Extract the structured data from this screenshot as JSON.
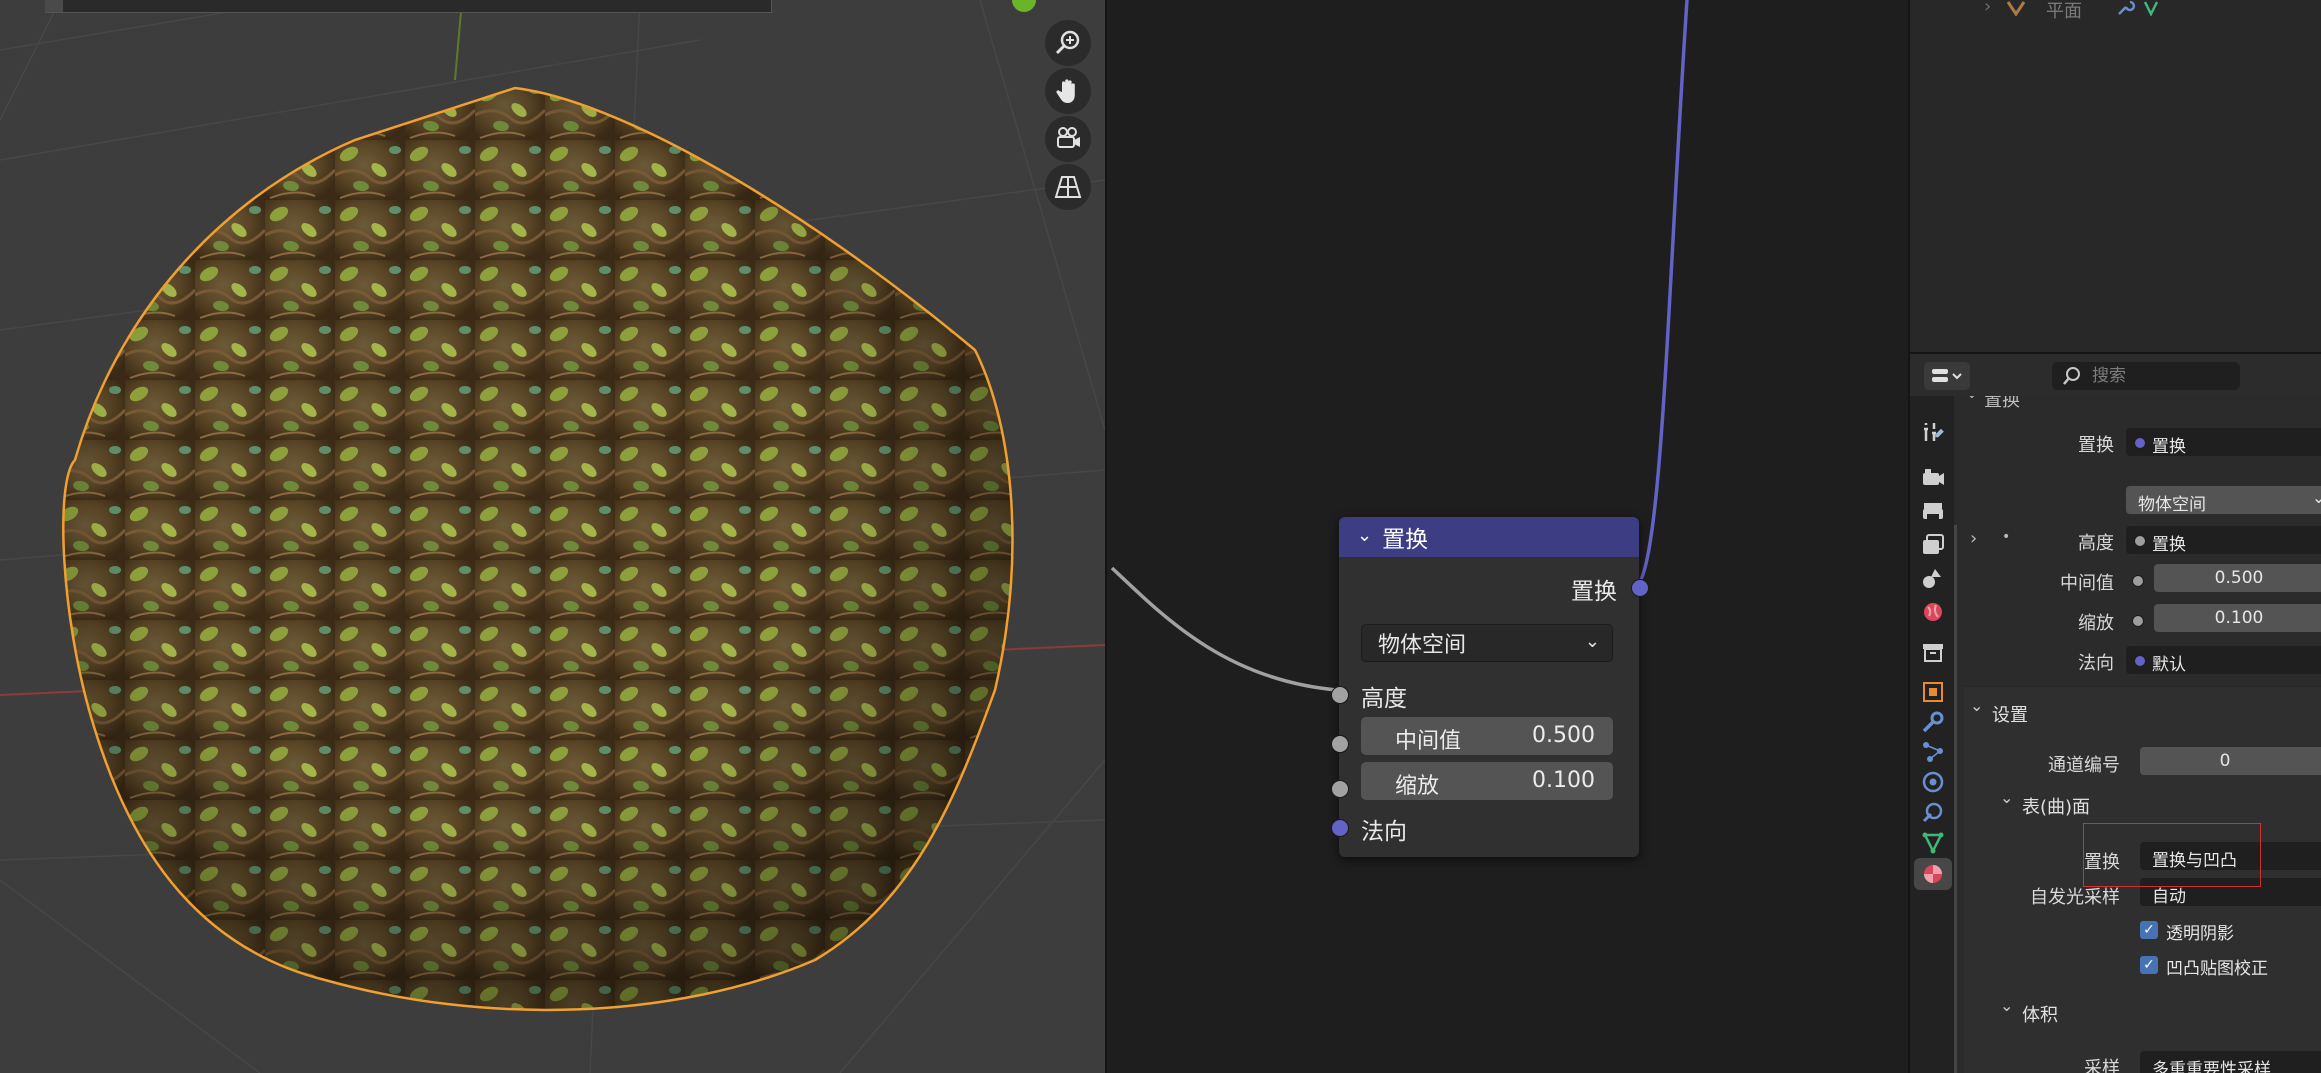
{
  "viewport": {
    "gizmo_buttons": [
      {
        "icon": "zoom-icon"
      },
      {
        "icon": "hand-pan-icon"
      },
      {
        "icon": "camera-icon"
      },
      {
        "icon": "perspective-grid-icon"
      }
    ]
  },
  "node": {
    "title": "置换",
    "output_label": "置换",
    "space_value": "物体空间",
    "inputs": {
      "height": "高度",
      "midlevel_label": "中间值",
      "midlevel_value": "0.500",
      "scale_label": "缩放",
      "scale_value": "0.100",
      "normal": "法向"
    }
  },
  "outliner": {
    "row_label": "平面"
  },
  "properties": {
    "search_placeholder": "搜索",
    "partial_header": "置换",
    "displacement": {
      "row_label": "置换",
      "row_value": "置换",
      "space_value": "物体空间",
      "height_label": "高度",
      "height_value": "置换",
      "midlevel_label": "中间值",
      "midlevel_value": "0.500",
      "scale_label": "缩放",
      "scale_value": "0.100",
      "normal_label": "法向",
      "normal_value": "默认"
    },
    "settings": {
      "title": "设置",
      "pass_index_label": "通道编号",
      "pass_index_value": "0",
      "surface": {
        "title": "表(曲)面",
        "displacement_label": "置换",
        "displacement_value": "置换与凹凸",
        "emission_label": "自发光采样",
        "emission_value": "自动",
        "transparent_shadow": "透明阴影",
        "bump_correction": "凹凸贴图校正"
      },
      "volume": {
        "title": "体积",
        "sampling_label": "采样",
        "sampling_value": "多重重要性采样"
      }
    }
  },
  "colors": {
    "node_header": "#3c3d82",
    "vector_socket": "#6363c7",
    "selection_outline": "#f0a030",
    "highlight_box": "#d03030",
    "checkbox": "#4772b3"
  }
}
